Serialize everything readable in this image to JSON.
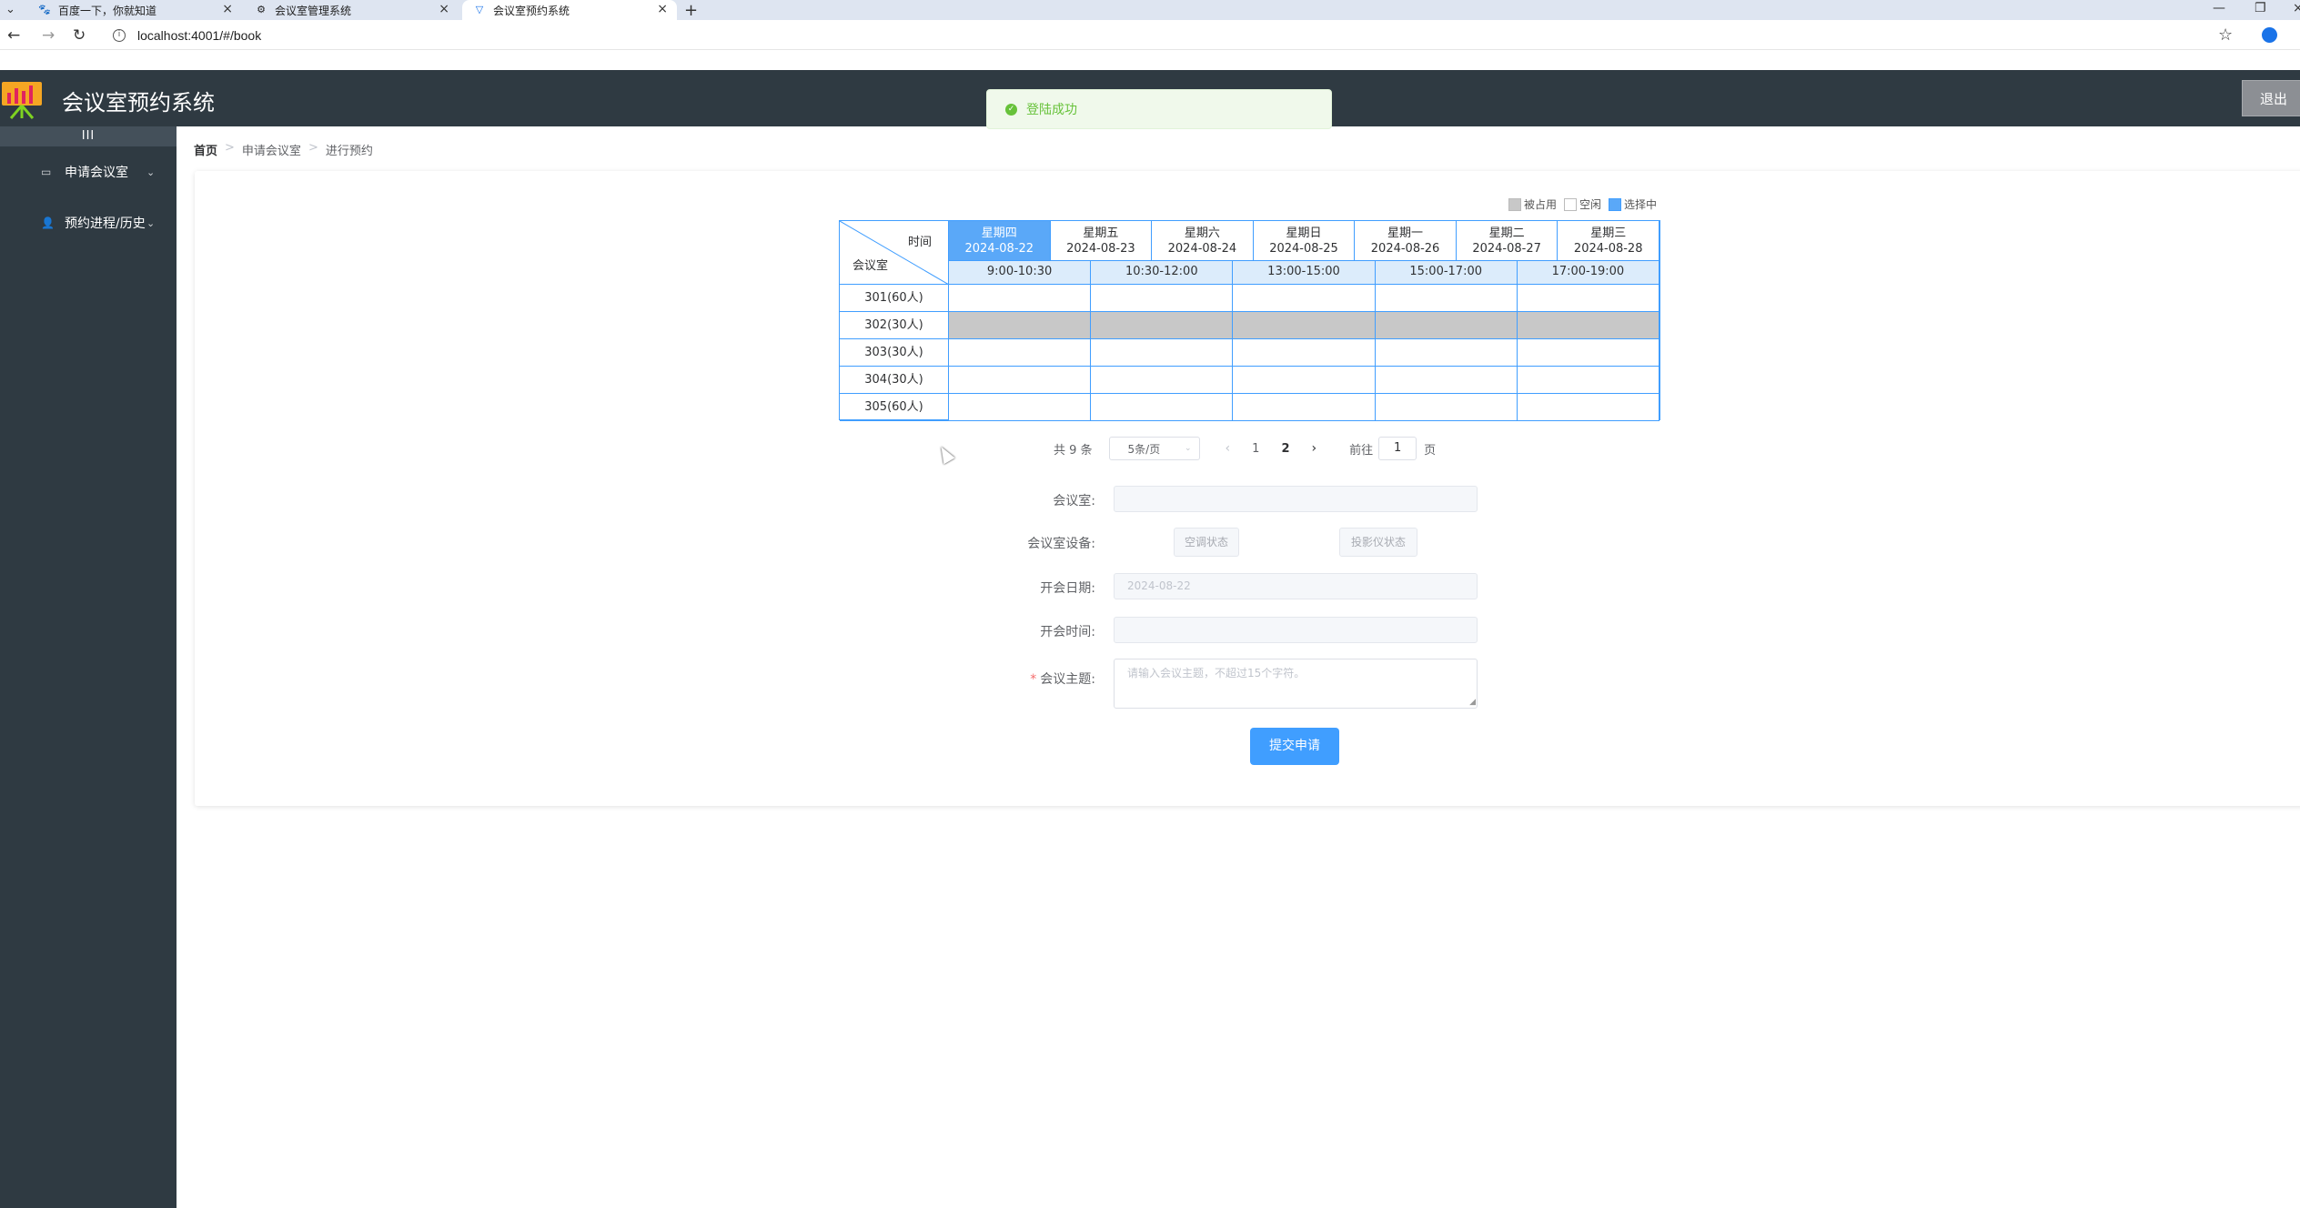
{
  "browser": {
    "tabs": [
      {
        "title": "百度一下，你就知道",
        "active": false
      },
      {
        "title": "会议室管理系统",
        "active": false
      },
      {
        "title": "会议室预约系统",
        "active": true
      }
    ],
    "new_tab_symbol": "+",
    "url": "localhost:4001/#/book"
  },
  "header": {
    "title": "会议室预约系统",
    "logout_label": "退出"
  },
  "toast": {
    "message": "登陆成功"
  },
  "sidebar": {
    "collapse_label": "III",
    "items": [
      {
        "label": "申请会议室",
        "icon": "chat-icon"
      },
      {
        "label": "预约进程/历史",
        "icon": "person-icon"
      }
    ]
  },
  "breadcrumb": [
    "首页",
    "申请会议室",
    "进行预约"
  ],
  "legend": {
    "occupied": "被占用",
    "free": "空闲",
    "selected": "选择中",
    "colors": {
      "occupied": "#c8c8c8",
      "free": "#ffffff",
      "selected": "#5aa8f8"
    }
  },
  "grid": {
    "corner_time": "时间",
    "corner_room": "会议室",
    "days": [
      {
        "weekday": "星期四",
        "date": "2024-08-22",
        "selected": true
      },
      {
        "weekday": "星期五",
        "date": "2024-08-23",
        "selected": false
      },
      {
        "weekday": "星期六",
        "date": "2024-08-24",
        "selected": false
      },
      {
        "weekday": "星期日",
        "date": "2024-08-25",
        "selected": false
      },
      {
        "weekday": "星期一",
        "date": "2024-08-26",
        "selected": false
      },
      {
        "weekday": "星期二",
        "date": "2024-08-27",
        "selected": false
      },
      {
        "weekday": "星期三",
        "date": "2024-08-28",
        "selected": false
      }
    ],
    "slots": [
      "9:00-10:30",
      "10:30-12:00",
      "13:00-15:00",
      "15:00-17:00",
      "17:00-19:00"
    ],
    "rooms": [
      {
        "name": "301(60人)",
        "occupied": [
          false,
          false,
          false,
          false,
          false
        ]
      },
      {
        "name": "302(30人)",
        "occupied": [
          true,
          true,
          true,
          true,
          true
        ]
      },
      {
        "name": "303(30人)",
        "occupied": [
          false,
          false,
          false,
          false,
          false
        ]
      },
      {
        "name": "304(30人)",
        "occupied": [
          false,
          false,
          false,
          false,
          false
        ]
      },
      {
        "name": "305(60人)",
        "occupied": [
          false,
          false,
          false,
          false,
          false
        ]
      }
    ]
  },
  "pagination": {
    "total": "共 9 条",
    "page_size": "5条/页",
    "pages": [
      "1",
      "2"
    ],
    "current_page": "2",
    "goto_label": "前往",
    "goto_value": "1",
    "page_suffix": "页"
  },
  "form": {
    "room_label": "会议室:",
    "room_value": "",
    "equipment_label": "会议室设备:",
    "ac_button": "空调状态",
    "projector_button": "投影仪状态",
    "date_label": "开会日期:",
    "date_value": "2024-08-22",
    "time_label": "开会时间:",
    "time_value": "",
    "topic_label": "会议主题:",
    "topic_placeholder": "请输入会议主题，不超过15个字符。",
    "submit_label": "提交申请"
  }
}
